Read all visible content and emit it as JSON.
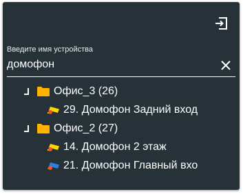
{
  "header": {
    "exit_icon": "exit-icon"
  },
  "search": {
    "label": "Введите имя устройства",
    "value": "домофон",
    "placeholder": "",
    "clear_icon": "close-icon"
  },
  "tree": {
    "groups": [
      {
        "label": "Офис_3 (26)",
        "expanded": true,
        "devices": [
          {
            "label": "29. Домофон Задний вход",
            "icon": "camera-icon",
            "color": "#ffd600"
          }
        ]
      },
      {
        "label": "Офис_2 (27)",
        "expanded": true,
        "devices": [
          {
            "label": "14. Домофон 2 этаж",
            "icon": "camera-icon",
            "color": "#ffd600"
          },
          {
            "label": "21. Домофон Главный вхо",
            "icon": "camera-icon",
            "color": "#2f7fe0"
          }
        ]
      }
    ]
  },
  "colors": {
    "panel_bg": "#263238",
    "folder": "#ffb300",
    "camera_yellow": "#ffd600",
    "camera_blue": "#2f7fe0",
    "alert_dot": "#f4511e"
  }
}
